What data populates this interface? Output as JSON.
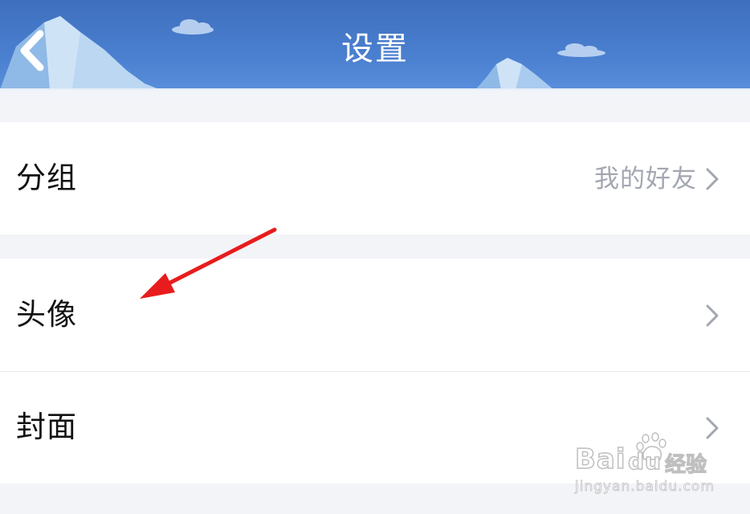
{
  "header": {
    "title": "设置",
    "back_icon": "chevron-left-icon",
    "colors": {
      "sky_top": "#3e6fbe",
      "sky_bottom": "#5c92de",
      "ice": "#b9d6f2"
    }
  },
  "settings": {
    "group1": [
      {
        "label": "分组",
        "value": "我的好友",
        "icon": "chevron-right-icon"
      }
    ],
    "group2": [
      {
        "label": "头像",
        "value": "",
        "icon": "chevron-right-icon"
      },
      {
        "label": "封面",
        "value": "",
        "icon": "chevron-right-icon"
      }
    ]
  },
  "annotation": {
    "type": "arrow",
    "color": "#e81c1c",
    "points_to": "头像"
  },
  "watermark": {
    "brand": "Bai",
    "brand_suffix": "du",
    "product": "经验",
    "url": "jingyan.baidu.com"
  },
  "colors": {
    "page_background": "#f3f4f8",
    "row_background": "#ffffff",
    "label_text": "#111111",
    "value_text": "#a3a7b1",
    "divider": "#e7e8ec"
  }
}
